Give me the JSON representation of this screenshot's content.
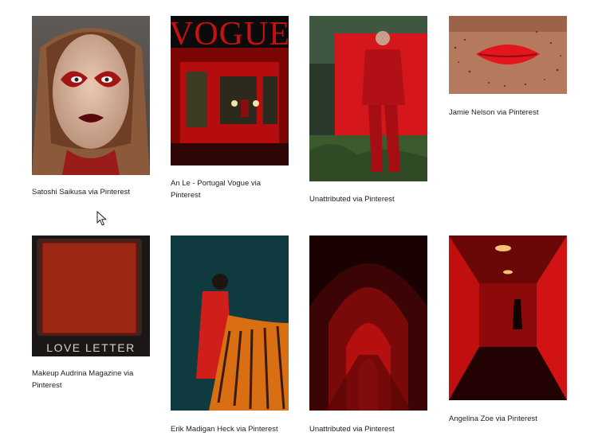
{
  "gallery": {
    "items": [
      {
        "caption": "Satoshi Saikusa via Pinterest"
      },
      {
        "caption": "An Le - Portugal Vogue via Pinterest",
        "magazine_title": "VOGUE"
      },
      {
        "caption": "Unattributed via Pinterest"
      },
      {
        "caption": "Jamie Nelson via Pinterest"
      },
      {
        "caption": "Makeup Audrina Magazine via Pinterest",
        "palette_label": "LOVE LETTER"
      },
      {
        "caption": "Erik Madigan Heck via Pinterest"
      },
      {
        "caption": "Unattributed via Pinterest"
      },
      {
        "caption": "Angelina Zoe via Pinterest"
      }
    ]
  },
  "colors": {
    "accent_red": "#d21414",
    "dark_red": "#6b0a0a",
    "teal": "#0f3a3f"
  },
  "cursor": {
    "icon": "mouse-pointer-icon"
  }
}
